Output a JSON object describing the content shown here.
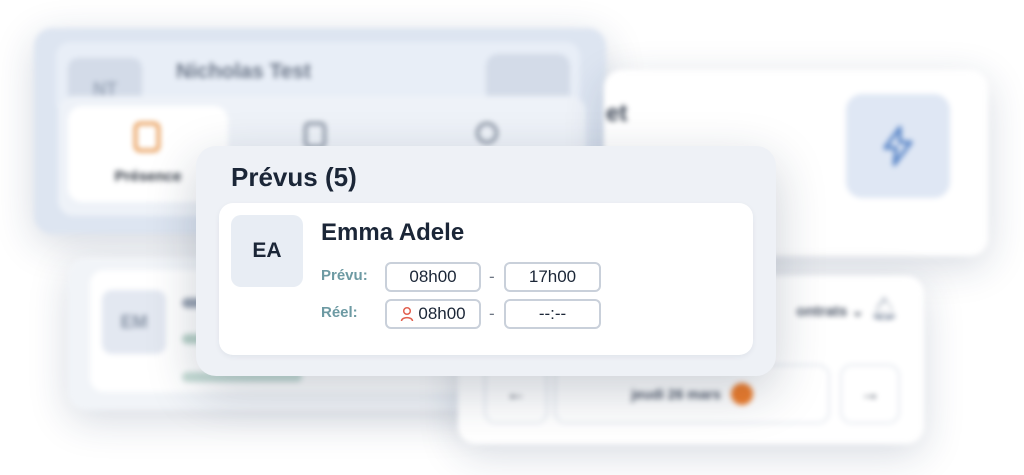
{
  "background": {
    "profile_card": {
      "initials": "NT",
      "name": "Nicholas Test",
      "tabs": [
        {
          "label": "Présence",
          "icon": "clipboard-check-icon",
          "active": true
        },
        {
          "label": "",
          "icon": "document-icon",
          "active": false
        },
        {
          "label": "",
          "icon": "user-icon",
          "active": false
        }
      ]
    },
    "right_card": {
      "title_fragment": "et",
      "icon": "bolt-icon"
    },
    "bottom_card": {
      "initials": "EM"
    },
    "calendar_card": {
      "contracts_label": "ontrats",
      "date_label": "jeudi 26 mars",
      "prev_icon": "arrow-left-icon",
      "next_icon": "arrow-right-icon",
      "bell_icon": "bell-icon"
    }
  },
  "modal": {
    "title": "Prévus (5)",
    "person": {
      "initials": "EA",
      "name": "Emma Adele",
      "planned_label": "Prévu:",
      "planned_start": "08h00",
      "planned_end": "17h00",
      "actual_label": "Réel:",
      "actual_start": "08h00",
      "actual_end": "--:--",
      "separator": "-"
    }
  },
  "colors": {
    "accent_orange": "#ee7d2c",
    "label_teal": "#6d9aa3",
    "person_icon_red": "#e2604f"
  }
}
